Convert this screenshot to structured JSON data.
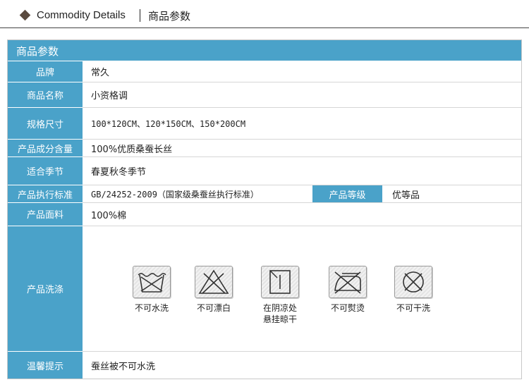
{
  "header": {
    "title_en": "Commodity Details",
    "title_cn": "商品参数"
  },
  "table": {
    "title": "商品参数",
    "rows": [
      {
        "label": "品牌",
        "value": "常久"
      },
      {
        "label": "商品名称",
        "value": "小资格调"
      },
      {
        "label": "规格尺寸",
        "value": "100*120CM、120*150CM、150*200CM"
      },
      {
        "label": "产品成分含量",
        "value": "100%优质桑蚕长丝"
      },
      {
        "label": "适合季节",
        "value": "春夏秋冬季节"
      },
      {
        "label": "产品执行标准",
        "value": "GB/24252-2009（国家级桑蚕丝执行标准）"
      },
      {
        "label": "产品面料",
        "value": "100%棉"
      },
      {
        "label": "产品洗涤",
        "value": ""
      },
      {
        "label": "温馨提示",
        "value": "蚕丝被不可水洗"
      }
    ],
    "grade": {
      "label": "产品等级",
      "value": "优等品"
    },
    "care_icons": [
      {
        "icon": "no-wash-icon",
        "caption_lines": [
          "不可水洗"
        ]
      },
      {
        "icon": "no-bleach-icon",
        "caption_lines": [
          "不可漂白"
        ]
      },
      {
        "icon": "line-dry-shade-icon",
        "caption_lines": [
          "在阴凉处",
          "悬挂晾干"
        ]
      },
      {
        "icon": "no-iron-icon",
        "caption_lines": [
          "不可熨烫"
        ]
      },
      {
        "icon": "no-dry-clean-icon",
        "caption_lines": [
          "不可干洗"
        ]
      }
    ]
  },
  "colors": {
    "accent": "#4aa2c9",
    "header_diamond": "#5a4a3e"
  }
}
